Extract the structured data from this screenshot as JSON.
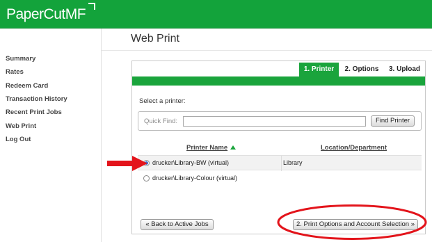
{
  "header": {
    "logo_text": "PaperCut",
    "logo_suffix": "MF"
  },
  "sidebar": {
    "items": [
      {
        "label": "Summary"
      },
      {
        "label": "Rates"
      },
      {
        "label": "Redeem Card"
      },
      {
        "label": "Transaction History"
      },
      {
        "label": "Recent Print Jobs"
      },
      {
        "label": "Web Print"
      },
      {
        "label": "Log Out"
      }
    ]
  },
  "main": {
    "title": "Web Print",
    "tabs": [
      {
        "label": "1. Printer",
        "active": true
      },
      {
        "label": "2. Options",
        "active": false
      },
      {
        "label": "3. Upload",
        "active": false
      }
    ],
    "select_label": "Select a printer:",
    "quick_find": {
      "label": "Quick Find:",
      "value": "",
      "button": "Find Printer"
    },
    "table": {
      "headers": [
        "Printer Name",
        "Location/Department"
      ],
      "rows": [
        {
          "name": "drucker\\Library-BW (virtual)",
          "location": "Library",
          "selected": true
        },
        {
          "name": "drucker\\Library-Colour (virtual)",
          "location": "",
          "selected": false
        }
      ]
    },
    "back_button": "« Back to Active Jobs",
    "next_button": "2. Print Options and Account Selection »"
  },
  "colors": {
    "brand_green": "#13a33b",
    "annotation_red": "#e3141b",
    "radio_blue": "#3a6fd0"
  }
}
